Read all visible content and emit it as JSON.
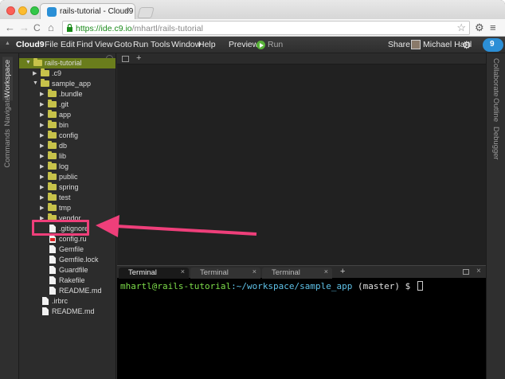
{
  "browser": {
    "tab_title": "rails-tutorial - Cloud9",
    "tab_close": "×",
    "url_host": "https://ide.c9.io",
    "url_path": "/mhartl/rails-tutorial",
    "nav": {
      "back": "←",
      "forward": "→",
      "reload": "C",
      "home": "⌂"
    },
    "star_icon": "star-icon",
    "gear_icon": "gear-icon",
    "menu_icon": "menu-icon"
  },
  "menubar": {
    "brand": "Cloud9",
    "items": [
      "File",
      "Edit",
      "Find",
      "View",
      "Goto",
      "Run",
      "Tools",
      "Window",
      "Help"
    ],
    "preview": "Preview",
    "run": "Run",
    "share": "Share",
    "user": "Michael Hartl",
    "badge": "9"
  },
  "left_tabs": [
    "Workspace",
    "Navigate",
    "Commands"
  ],
  "right_tabs": [
    "Collaborate",
    "Outline",
    "Debugger"
  ],
  "file_tree": [
    {
      "label": "rails-tutorial",
      "kind": "folder",
      "expanded": true,
      "selected": true
    },
    {
      "label": ".c9",
      "kind": "folder",
      "expanded": false
    },
    {
      "label": "sample_app",
      "kind": "folder",
      "expanded": true
    },
    {
      "label": ".bundle",
      "kind": "folder",
      "expanded": false
    },
    {
      "label": ".git",
      "kind": "folder",
      "expanded": false
    },
    {
      "label": "app",
      "kind": "folder",
      "expanded": false
    },
    {
      "label": "bin",
      "kind": "folder",
      "expanded": false
    },
    {
      "label": "config",
      "kind": "folder",
      "expanded": false
    },
    {
      "label": "db",
      "kind": "folder",
      "expanded": false
    },
    {
      "label": "lib",
      "kind": "folder",
      "expanded": false
    },
    {
      "label": "log",
      "kind": "folder",
      "expanded": false
    },
    {
      "label": "public",
      "kind": "folder",
      "expanded": false
    },
    {
      "label": "spring",
      "kind": "folder",
      "expanded": false
    },
    {
      "label": "test",
      "kind": "folder",
      "expanded": false
    },
    {
      "label": "tmp",
      "kind": "folder",
      "expanded": false
    },
    {
      "label": "vendor",
      "kind": "folder",
      "expanded": false
    },
    {
      "label": ".gitignore",
      "kind": "file"
    },
    {
      "label": "config.ru",
      "kind": "file-ruby"
    },
    {
      "label": "Gemfile",
      "kind": "file"
    },
    {
      "label": "Gemfile.lock",
      "kind": "file"
    },
    {
      "label": "Guardfile",
      "kind": "file"
    },
    {
      "label": "Rakefile",
      "kind": "file"
    },
    {
      "label": "README.md",
      "kind": "file"
    },
    {
      "label": ".irbrc",
      "kind": "file"
    },
    {
      "label": "README.md",
      "kind": "file"
    }
  ],
  "editor": {
    "add_tab": "+"
  },
  "terminal": {
    "tabs": [
      "Terminal",
      "Terminal",
      "Terminal"
    ],
    "active_tab": 0,
    "tab_close": "×",
    "add": "+",
    "close": "×",
    "prompt_user": "mhartl@rails-tutorial",
    "prompt_path": ":~/workspace/sample_app",
    "prompt_branch": " (master) $ "
  },
  "annotation": {
    "color": "#ee3f7a"
  }
}
